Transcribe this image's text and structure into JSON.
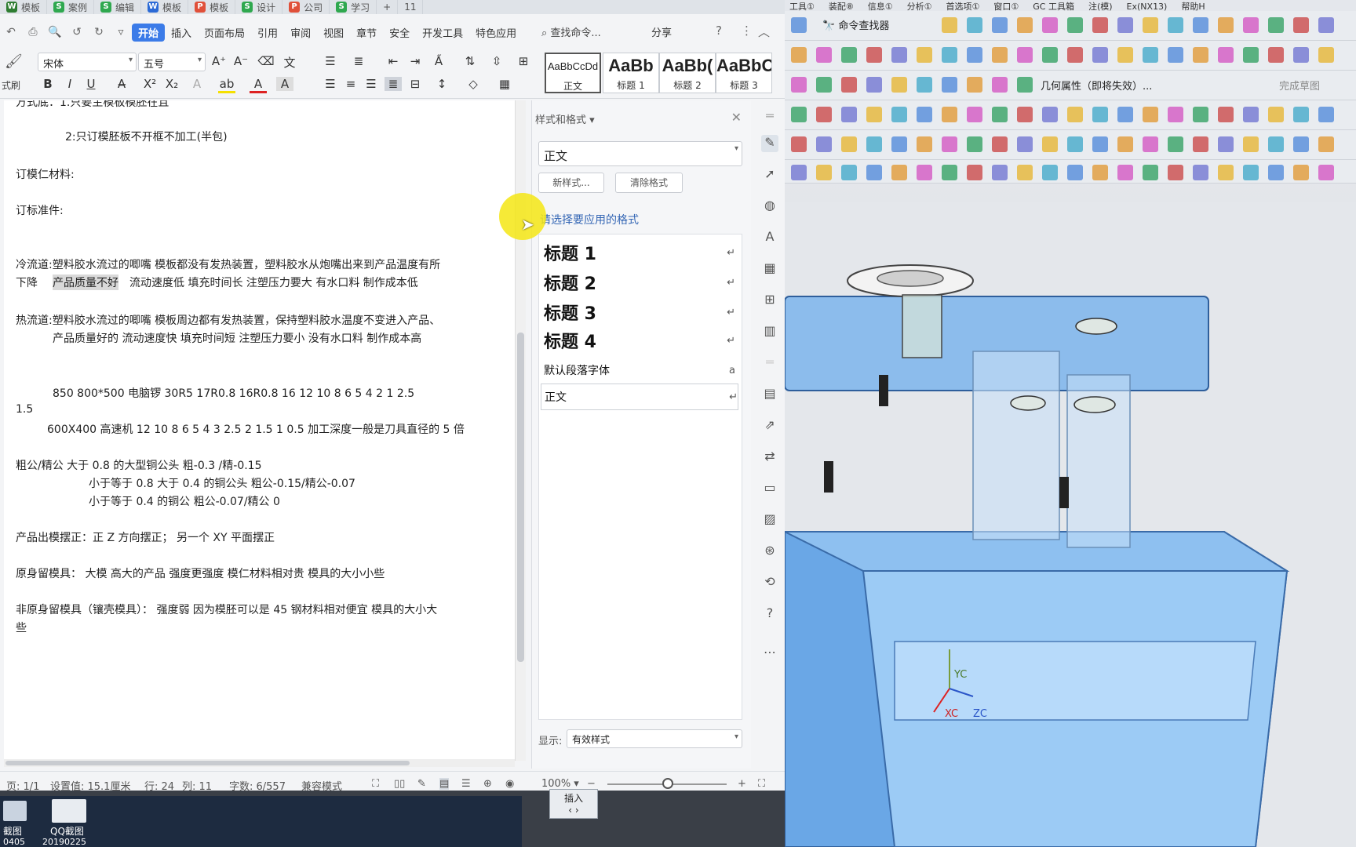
{
  "wps": {
    "tabs": [
      {
        "label": "模板",
        "color": "#2f7d32",
        "icon": "W"
      },
      {
        "label": "案例",
        "color": "#2fa84f",
        "icon": "S"
      },
      {
        "label": "编辑",
        "color": "#2fa84f",
        "icon": "S"
      },
      {
        "label": "模板",
        "color": "#2b6ad6",
        "icon": "W"
      },
      {
        "label": "模板",
        "color": "#e0503a",
        "icon": "P"
      },
      {
        "label": "设计",
        "color": "#2fa84f",
        "icon": "S"
      },
      {
        "label": "公司",
        "color": "#e0503a",
        "icon": "P"
      },
      {
        "label": "学习",
        "color": "#2fa84f",
        "icon": "S"
      }
    ],
    "tab_count": "11",
    "menu": [
      "开始",
      "插入",
      "页面布局",
      "引用",
      "审阅",
      "视图",
      "章节",
      "安全",
      "开发工具",
      "特色应用"
    ],
    "search_cmd": "查找命令...",
    "share": "分享",
    "font_name": "宋体",
    "font_size": "五号",
    "styles_gallery": [
      {
        "preview": "AaBbCcDd",
        "label": "正文"
      },
      {
        "preview": "AaBb",
        "label": "标题 1"
      },
      {
        "preview": "AaBb(",
        "label": "标题 2"
      },
      {
        "preview": "AaBbC",
        "label": "标题 3"
      }
    ],
    "style_button_label": "式刷",
    "document": {
      "lines": [
        "方式底：1.只要主模板模胚在且",
        "2:只订模胚板不开框不加工(半包)",
        "订模仁材料:",
        "订标准件:",
        "冷流道:塑料胶水流过的唧嘴 模板都没有发热装置，塑料胶水从炮嘴出来到产品温度有所",
        "下降 ",
        "产品质量不好",
        " 流动速度低 填充时间长 注塑压力要大 有水口料 制作成本低",
        "热流道:塑料胶水流过的唧嘴 模板周边都有发热装置，保持塑料胶水温度不变进入产品、",
        "产品质量好的  流动速度快 填充时间短 注塑压力要小  没有水口料 制作成本高",
        "850  800*500 电脑锣 30R5  17R0.8 16R0.8  16  12  10  8  6  5  4  2  1  2.5",
        "1.5",
        "600X400 高速机  12 10 8 6 5 4 3 2.5 2 1.5 1 0.5 加工深度一般是刀具直径的 5 倍",
        "粗公/精公    大于 0.8 的大型铜公头 粗-0.3 /精-0.15",
        "小于等于 0.8 大于 0.4 的铜公头   粗公-0.15/精公-0.07",
        "小于等于 0.4 的铜公  粗公-0.07/精公 0",
        "产品出模摆正：正 Z 方向摆正；  另一个 XY 平面摆正",
        "原身留模具：  大模  高大的产品  强度更强度   模仁材料相对贵    模具的大小小些",
        "非原身留模具（镶壳模具）：  强度弱   因为模胚可以是 45 钢材料相对便宜   模具的大小大",
        "些"
      ]
    },
    "styles_panel": {
      "title": "样式和格式 ▾",
      "current": "正文",
      "new_style": "新样式...",
      "clear_format": "清除格式",
      "hint": "请选择要应用的格式",
      "items": [
        {
          "label": "标题  1",
          "mark": "↵"
        },
        {
          "label": "标题  2",
          "mark": "↵"
        },
        {
          "label": "标题  3",
          "mark": "↵"
        },
        {
          "label": "标题  4",
          "mark": "↵"
        },
        {
          "label": "默认段落字体",
          "mark": "a"
        },
        {
          "label": "正文",
          "mark": "↵"
        }
      ],
      "show_label": "显示:",
      "show_value": "有效样式"
    },
    "status": {
      "page": "页: 1/1",
      "setting": "设置值: 15.1厘米",
      "row": "行: 24",
      "col": "列: 11",
      "words": "字数: 6/557",
      "mode": "兼容模式",
      "zoom": "100% ▾"
    }
  },
  "desktop": {
    "icons": [
      {
        "label": "截图"
      },
      {
        "label": "QQ截图"
      }
    ],
    "sub_labels": [
      "0405",
      "20190225"
    ]
  },
  "nx": {
    "menu": [
      "工具①",
      "装配⑧",
      "信息①",
      "分析①",
      "首选项①",
      "窗口①",
      "GC 工具箱",
      "注(模)",
      "Ex(NX13)",
      "帮助H"
    ],
    "cmd_finder": "命令查找器",
    "geom_props": "几何属性（即将失效）...",
    "finish_sketch": "完成草图",
    "axes": {
      "yc": "YC",
      "xc": "XC",
      "zc": "ZC"
    },
    "tooltip": "插入"
  }
}
